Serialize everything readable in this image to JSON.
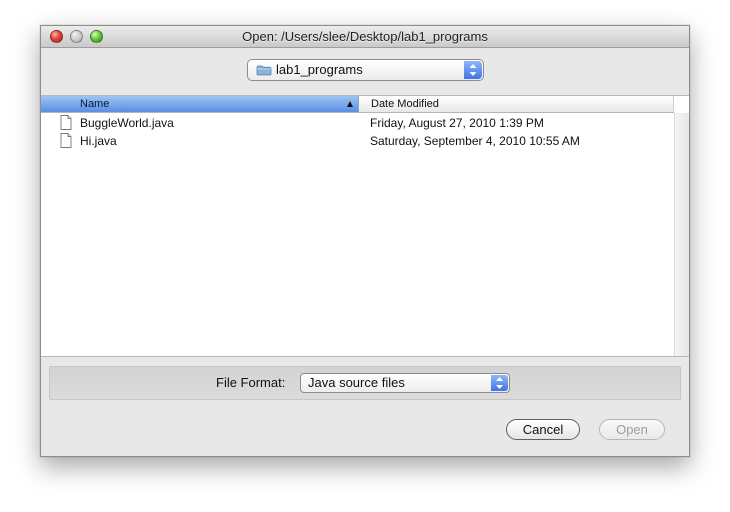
{
  "window": {
    "title": "Open:  /Users/slee/Desktop/lab1_programs"
  },
  "location_popup": {
    "selected": "lab1_programs",
    "icon": "folder-icon"
  },
  "file_table": {
    "columns": [
      {
        "label": "Name",
        "sorted": "ascending"
      },
      {
        "label": "Date Modified"
      }
    ],
    "rows": [
      {
        "name": "BuggleWorld.java",
        "date_modified": "Friday, August 27, 2010 1:39 PM",
        "icon": "document-icon"
      },
      {
        "name": "Hi.java",
        "date_modified": "Saturday, September 4, 2010 10:55 AM",
        "icon": "document-icon"
      }
    ]
  },
  "file_format": {
    "label": "File Format:",
    "selected": "Java source files"
  },
  "buttons": {
    "cancel": "Cancel",
    "open": "Open"
  },
  "colors": {
    "selection_blue": "#5a8ee2",
    "popup_arrow_blue": "#3f74e6",
    "close_red": "#e0443b",
    "zoom_green": "#5cc63b",
    "disabled_text": "#9d9d9d"
  }
}
